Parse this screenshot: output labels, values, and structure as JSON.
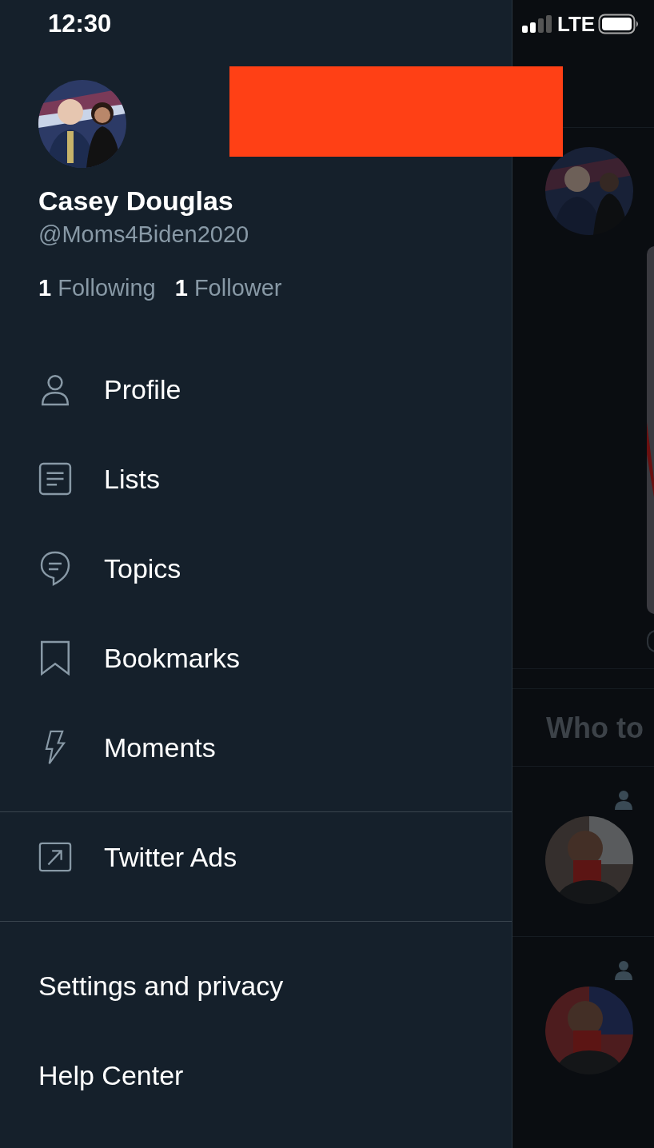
{
  "status_bar": {
    "time": "12:30",
    "network": "LTE"
  },
  "drawer": {
    "name": "Casey Douglas",
    "handle": "@Moms4Biden2020",
    "following": {
      "count": "1",
      "label": "Following"
    },
    "followers": {
      "count": "1",
      "label": "Follower"
    },
    "menu": [
      {
        "kind": "profile",
        "label": "Profile"
      },
      {
        "kind": "lists",
        "label": "Lists"
      },
      {
        "kind": "topics",
        "label": "Topics"
      },
      {
        "kind": "bookmarks",
        "label": "Bookmarks"
      },
      {
        "kind": "moments",
        "label": "Moments"
      }
    ],
    "ads": {
      "label": "Twitter Ads"
    },
    "footer": [
      "Settings and privacy",
      "Help Center"
    ]
  },
  "timeline": {
    "who_to_follow": "Who to"
  }
}
